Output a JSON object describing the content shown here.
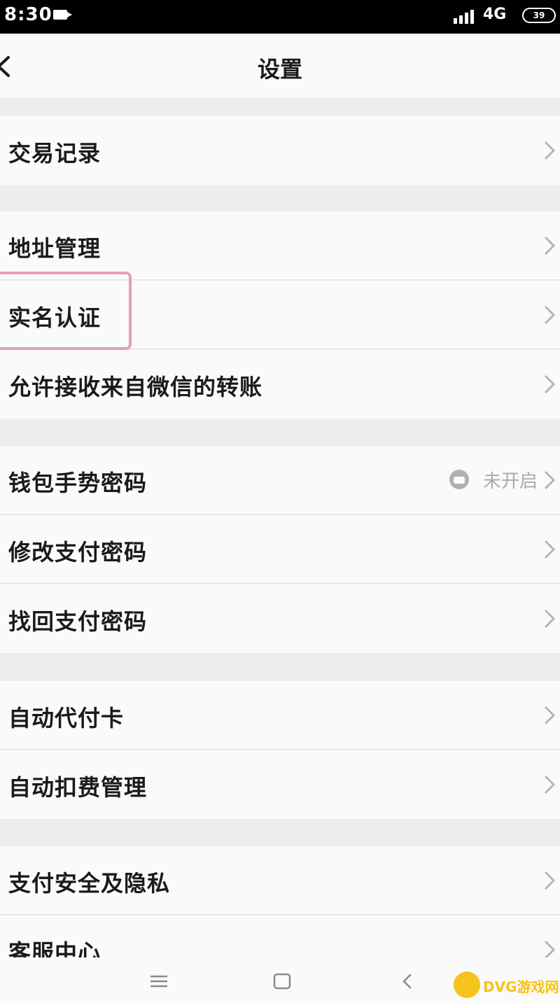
{
  "status_bar": {
    "time": "8:30",
    "network": "4G",
    "battery": "39"
  },
  "header": {
    "title": "设置"
  },
  "menu": {
    "transaction_records": "交易记录",
    "address_management": "地址管理",
    "real_name_auth": "实名认证",
    "allow_wechat_transfer": "允许接收来自微信的转账",
    "wallet_gesture_password": "钱包手势密码",
    "wallet_gesture_status": "未开启",
    "change_pay_password": "修改支付密码",
    "recover_pay_password": "找回支付密码",
    "auto_pay_card": "自动代付卡",
    "auto_deduction_management": "自动扣费管理",
    "pay_security_privacy": "支付安全及隐私",
    "customer_service": "客服中心"
  },
  "watermark": {
    "text": "DVG游戏网"
  },
  "colors": {
    "background": "#ededed",
    "row": "#fafafa",
    "highlight": "#e2a2ad",
    "chevron": "#b5b5b5",
    "watermark": "#f5c31b"
  },
  "icons": [
    "back-arrow-icon",
    "chevron-right-icon",
    "lock-icon",
    "menu-lines-icon",
    "home-square-icon",
    "back-triangle-icon",
    "gamepad-logo-icon"
  ]
}
